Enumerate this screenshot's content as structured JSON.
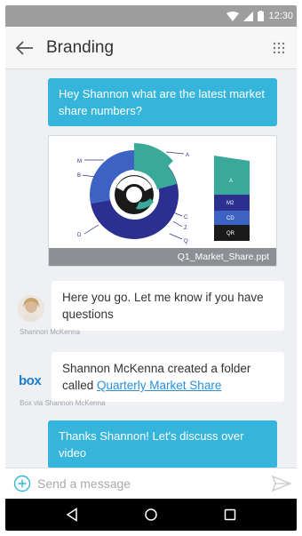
{
  "status_bar": {
    "time": "12:30"
  },
  "app_bar": {
    "title": "Branding"
  },
  "messages": {
    "m1": "Hey Shannon what are the latest market share numbers?",
    "attachment_file": "Q1_Market_Share.ppt",
    "chart_labels": {
      "m": "M",
      "b": "B",
      "d": "D",
      "a": "A",
      "c": "C",
      "z": "Z",
      "q": "Q",
      "bar_a": "A",
      "bar_m2": "M2",
      "bar_cd": "CD",
      "bar_qr": "QR"
    },
    "m2": "Here you go. Let me know if you have questions",
    "m2_sender": "Shannon McKenna",
    "m3_prefix": "Shannon McKenna created a folder called ",
    "m3_link": "Quarterly Market Share",
    "m3_sender": "Box via Shannon McKenna",
    "box_logo": "box",
    "m4": "Thanks Shannon! Let's discuss over video"
  },
  "composer": {
    "placeholder": "Send a message"
  },
  "colors": {
    "outgoing_bubble": "#35b5dc",
    "chart_teal": "#3aa99a",
    "chart_navy": "#2b2f8f",
    "chart_blue": "#3c63c4",
    "chart_black": "#1a1a1a"
  },
  "icons": {
    "back": "arrow-left-icon",
    "grid": "grid-icon",
    "add": "plus-circle-icon",
    "send": "send-icon"
  }
}
